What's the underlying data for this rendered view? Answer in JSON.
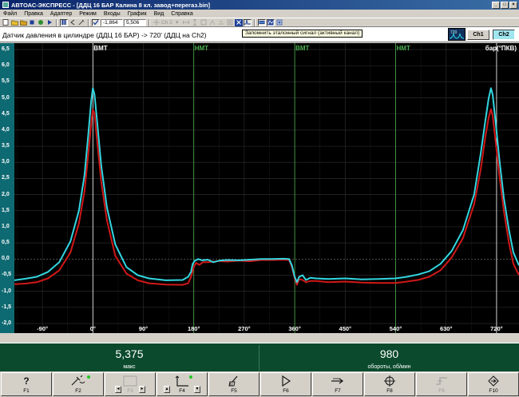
{
  "window": {
    "title": "АВТОАС-ЭКСПРЕСС - [ДДЦ 16 БАР Калина 8 кл. завод+перегаз.bin]",
    "controls": [
      "_",
      "□",
      "×"
    ]
  },
  "menu": [
    "Файл",
    "Правка",
    "Адаптер",
    "Режим",
    "Входы",
    "График",
    "Вид",
    "Справка"
  ],
  "toolbar": {
    "field1": "-1,864",
    "field2": "5,506",
    "ch_label": "Ch 2",
    "tooltip": "Запомнить эталонный сигнал (активный канал)"
  },
  "chart_header": {
    "title": "Датчик давления в цилиндре (ДДЦ 16 БАР) -> 720' (ДДЦ на Ch2)",
    "ch1": "Ch1",
    "ch2": "Ch2",
    "thumb_label": "720"
  },
  "chart_data": {
    "type": "line",
    "unit_label": "бар(°ПКВ)",
    "x_ticks": [
      "-90°",
      "0°",
      "90°",
      "180°",
      "270°",
      "360°",
      "450°",
      "540°",
      "630°",
      "720°"
    ],
    "xlim": [
      -140,
      760
    ],
    "y_ticks": [
      "6,5",
      "6,0",
      "5,5",
      "5,0",
      "4,5",
      "4,0",
      "3,5",
      "3,0",
      "2,5",
      "2,0",
      "1,5",
      "1,0",
      "0,5",
      "0,0",
      "-0,5",
      "-1,0",
      "-1,5",
      "-2,0"
    ],
    "ylim": [
      -2.0,
      6.5
    ],
    "markers": [
      {
        "label": "ВМТ",
        "x": 0,
        "color": "#ffffff"
      },
      {
        "label": "НМТ",
        "x": 180,
        "color": "#4caf50"
      },
      {
        "label": "ВМТ",
        "x": 360,
        "color": "#4caf50"
      },
      {
        "label": "НМТ",
        "x": 540,
        "color": "#4caf50"
      },
      {
        "label": "",
        "x": 720,
        "color": "#ffffff"
      }
    ],
    "grid": true,
    "series": [
      {
        "color": "#33d6e0",
        "points": [
          [
            -140,
            -0.66
          ],
          [
            -120,
            -0.61
          ],
          [
            -100,
            -0.55
          ],
          [
            -80,
            -0.4
          ],
          [
            -60,
            -0.1
          ],
          [
            -40,
            0.55
          ],
          [
            -25,
            1.5
          ],
          [
            -15,
            2.6
          ],
          [
            -8,
            3.9
          ],
          [
            -3,
            4.9
          ],
          [
            0,
            5.3
          ],
          [
            3,
            5.1
          ],
          [
            8,
            4.2
          ],
          [
            15,
            2.9
          ],
          [
            25,
            1.6
          ],
          [
            40,
            0.45
          ],
          [
            60,
            -0.25
          ],
          [
            80,
            -0.5
          ],
          [
            100,
            -0.6
          ],
          [
            130,
            -0.66
          ],
          [
            160,
            -0.65
          ],
          [
            170,
            -0.55
          ],
          [
            175,
            -0.4
          ],
          [
            178,
            -0.15
          ],
          [
            182,
            -0.05
          ],
          [
            188,
            0.0
          ],
          [
            195,
            -0.04
          ],
          [
            205,
            -0.02
          ],
          [
            215,
            -0.1
          ],
          [
            225,
            -0.05
          ],
          [
            240,
            -0.03
          ],
          [
            260,
            -0.04
          ],
          [
            280,
            -0.02
          ],
          [
            300,
            0.0
          ],
          [
            320,
            0.0
          ],
          [
            340,
            0.01
          ],
          [
            350,
            0.0
          ],
          [
            355,
            -0.2
          ],
          [
            360,
            -0.55
          ],
          [
            364,
            -0.72
          ],
          [
            368,
            -0.55
          ],
          [
            374,
            -0.5
          ],
          [
            380,
            -0.65
          ],
          [
            388,
            -0.58
          ],
          [
            398,
            -0.6
          ],
          [
            420,
            -0.62
          ],
          [
            450,
            -0.6
          ],
          [
            480,
            -0.63
          ],
          [
            510,
            -0.62
          ],
          [
            540,
            -0.6
          ],
          [
            560,
            -0.55
          ],
          [
            580,
            -0.48
          ],
          [
            600,
            -0.38
          ],
          [
            620,
            -0.15
          ],
          [
            640,
            0.25
          ],
          [
            660,
            0.9
          ],
          [
            680,
            2.0
          ],
          [
            692,
            3.3
          ],
          [
            700,
            4.3
          ],
          [
            706,
            5.0
          ],
          [
            710,
            5.3
          ],
          [
            713,
            5.1
          ],
          [
            718,
            4.3
          ],
          [
            725,
            3.1
          ],
          [
            733,
            1.9
          ],
          [
            742,
            0.9
          ],
          [
            750,
            0.2
          ],
          [
            760,
            -0.2
          ]
        ]
      },
      {
        "color": "#d01818",
        "points": [
          [
            -140,
            -0.78
          ],
          [
            -120,
            -0.76
          ],
          [
            -100,
            -0.72
          ],
          [
            -80,
            -0.6
          ],
          [
            -60,
            -0.35
          ],
          [
            -40,
            0.2
          ],
          [
            -25,
            1.1
          ],
          [
            -15,
            2.1
          ],
          [
            -8,
            3.3
          ],
          [
            -3,
            4.2
          ],
          [
            0,
            4.65
          ],
          [
            3,
            4.5
          ],
          [
            8,
            3.6
          ],
          [
            15,
            2.4
          ],
          [
            25,
            1.2
          ],
          [
            40,
            0.1
          ],
          [
            60,
            -0.45
          ],
          [
            80,
            -0.66
          ],
          [
            100,
            -0.75
          ],
          [
            130,
            -0.79
          ],
          [
            160,
            -0.8
          ],
          [
            170,
            -0.75
          ],
          [
            175,
            -0.55
          ],
          [
            180,
            -0.25
          ],
          [
            184,
            -0.12
          ],
          [
            190,
            -0.18
          ],
          [
            196,
            -0.1
          ],
          [
            205,
            -0.1
          ],
          [
            215,
            -0.08
          ],
          [
            225,
            -0.06
          ],
          [
            240,
            -0.08
          ],
          [
            260,
            -0.05
          ],
          [
            280,
            -0.07
          ],
          [
            300,
            -0.03
          ],
          [
            320,
            -0.03
          ],
          [
            340,
            -0.02
          ],
          [
            350,
            -0.03
          ],
          [
            355,
            -0.25
          ],
          [
            360,
            -0.6
          ],
          [
            364,
            -0.8
          ],
          [
            368,
            -0.62
          ],
          [
            374,
            -0.65
          ],
          [
            380,
            -0.72
          ],
          [
            388,
            -0.68
          ],
          [
            398,
            -0.68
          ],
          [
            420,
            -0.72
          ],
          [
            450,
            -0.7
          ],
          [
            480,
            -0.73
          ],
          [
            510,
            -0.74
          ],
          [
            540,
            -0.74
          ],
          [
            560,
            -0.7
          ],
          [
            580,
            -0.65
          ],
          [
            600,
            -0.55
          ],
          [
            620,
            -0.35
          ],
          [
            640,
            0.05
          ],
          [
            660,
            0.65
          ],
          [
            680,
            1.7
          ],
          [
            692,
            2.8
          ],
          [
            700,
            3.8
          ],
          [
            706,
            4.4
          ],
          [
            710,
            4.65
          ],
          [
            713,
            4.45
          ],
          [
            718,
            3.7
          ],
          [
            725,
            2.6
          ],
          [
            733,
            1.5
          ],
          [
            742,
            0.5
          ],
          [
            750,
            -0.15
          ],
          [
            760,
            -0.5
          ]
        ]
      }
    ]
  },
  "readouts": {
    "left_value": "5,375",
    "left_label": "макс",
    "right_value": "980",
    "right_label": "обороты, об/мин"
  },
  "fkeys": [
    {
      "label": "F1",
      "icon": "help-icon"
    },
    {
      "label": "F2",
      "icon": "marker-icon"
    },
    {
      "label": "F3",
      "icon": "range-icon"
    },
    {
      "label": "F4",
      "icon": "cursor-icon"
    },
    {
      "label": "F5",
      "icon": "clear-icon"
    },
    {
      "label": "F6",
      "icon": "play-icon"
    },
    {
      "label": "F7",
      "icon": "arrow-right-icon"
    },
    {
      "label": "F8",
      "icon": "crosshair-icon"
    },
    {
      "label": "F9",
      "icon": "step-icon"
    },
    {
      "label": "F10",
      "icon": "exit-icon"
    }
  ]
}
